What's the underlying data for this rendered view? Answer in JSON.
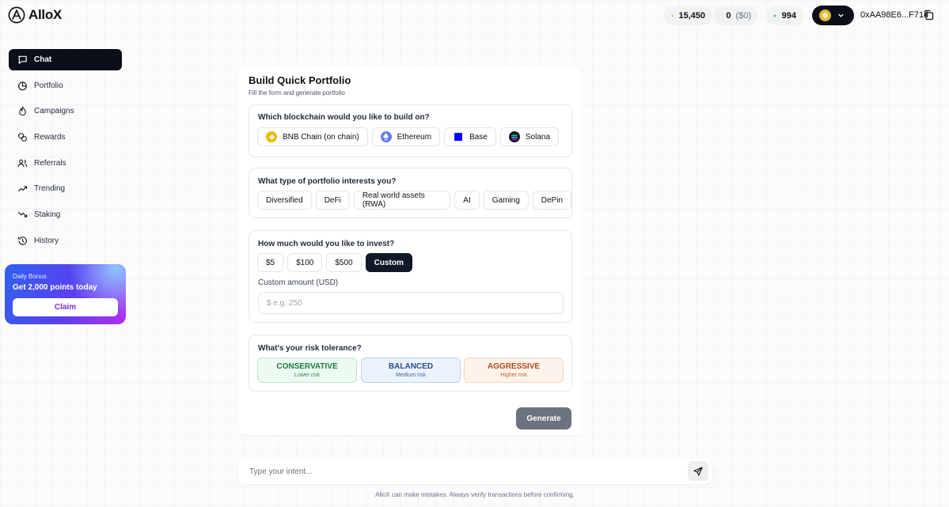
{
  "brand": {
    "name": "AlloX"
  },
  "header": {
    "points": "15,450",
    "gems": "0",
    "gems_usd": "($0)",
    "arrows": "994",
    "wallet_address": "0xAA98E6...F714"
  },
  "sidebar": {
    "items": [
      {
        "label": "Chat",
        "icon": "chat-icon"
      },
      {
        "label": "Portfolio",
        "icon": "pie-chart-icon"
      },
      {
        "label": "Campaigns",
        "icon": "flame-icon"
      },
      {
        "label": "Rewards",
        "icon": "coins-icon"
      },
      {
        "label": "Referrals",
        "icon": "users-icon"
      },
      {
        "label": "Trending",
        "icon": "trending-up-icon"
      },
      {
        "label": "Staking",
        "icon": "trending-down-icon"
      },
      {
        "label": "History",
        "icon": "history-icon"
      }
    ],
    "active": "Chat"
  },
  "bonus": {
    "small": "Daily Bonus",
    "title": "Get 2,000 points today",
    "button": "Claim"
  },
  "form": {
    "title": "Build Quick Portfolio",
    "subtitle": "Fill the form and generate portfolio",
    "chain": {
      "question": "Which blockchain would you like to build on?",
      "options": [
        "BNB Chain (on chain)",
        "Ethereum",
        "Base",
        "Solana"
      ]
    },
    "type": {
      "question": "What type of portfolio interests you?",
      "options": [
        "Diversified",
        "DeFi",
        "Real world assets (RWA)",
        "AI",
        "Gaming",
        "DePin"
      ]
    },
    "invest": {
      "question": "How much would you like to invest?",
      "options": [
        "$5",
        "$100",
        "$500",
        "Custom"
      ],
      "selected": "Custom",
      "custom_label": "Custom amount (USD)",
      "custom_placeholder": "$ e.g. 250"
    },
    "risk": {
      "question": "What's your risk tolerance?",
      "options": [
        {
          "name": "CONSERVATIVE",
          "sub": "Lower risk",
          "color": "#1f7a3e"
        },
        {
          "name": "BALANCED",
          "sub": "Medium risk",
          "color": "#2a4b8d"
        },
        {
          "name": "AGGRESSIVE",
          "sub": "Higher risk",
          "color": "#b5471b"
        }
      ]
    },
    "generate": "Generate"
  },
  "composer": {
    "placeholder": "Type your intent..."
  },
  "footer": {
    "disclaimer": "AlloX can make mistakes. Always verify transactions before confirming."
  },
  "colors": {
    "accent": "#0b0f19",
    "bonus_gradient": [
      "#2f62f0",
      "#b32ef2"
    ]
  }
}
